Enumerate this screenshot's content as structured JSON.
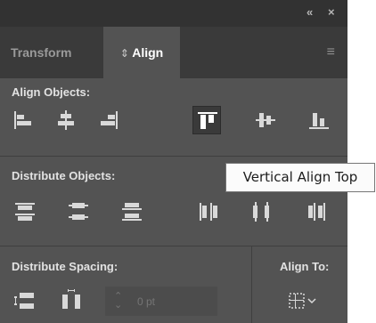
{
  "titlebar": {
    "collapse_icon": "«",
    "close_icon": "×"
  },
  "tabs": [
    {
      "label": "Transform",
      "active": false
    },
    {
      "label": "Align",
      "active": true,
      "prefix_icon": "⇕"
    }
  ],
  "panel_menu_icon": "≡",
  "sections": {
    "align_objects": {
      "label": "Align Objects:",
      "buttons": [
        "horizontal-align-left",
        "horizontal-align-center",
        "horizontal-align-right",
        "vertical-align-top",
        "vertical-align-center",
        "vertical-align-bottom"
      ],
      "selected": "vertical-align-top"
    },
    "distribute_objects": {
      "label": "Distribute Objects:",
      "buttons": [
        "vertical-distribute-top",
        "vertical-distribute-center",
        "vertical-distribute-bottom",
        "horizontal-distribute-left",
        "horizontal-distribute-center",
        "horizontal-distribute-right"
      ]
    },
    "distribute_spacing": {
      "label": "Distribute Spacing:",
      "buttons": [
        "vertical-distribute-space",
        "horizontal-distribute-space"
      ],
      "input_placeholder": "0 pt"
    },
    "align_to": {
      "label": "Align To:",
      "icon": "align-to-selection"
    }
  },
  "tooltip": {
    "text": "Vertical Align Top"
  },
  "colors": {
    "panel_bg": "#535353",
    "titlebar_bg": "#323232",
    "tab_bg": "#3a3a3a",
    "icon": "#d9d9d9"
  }
}
